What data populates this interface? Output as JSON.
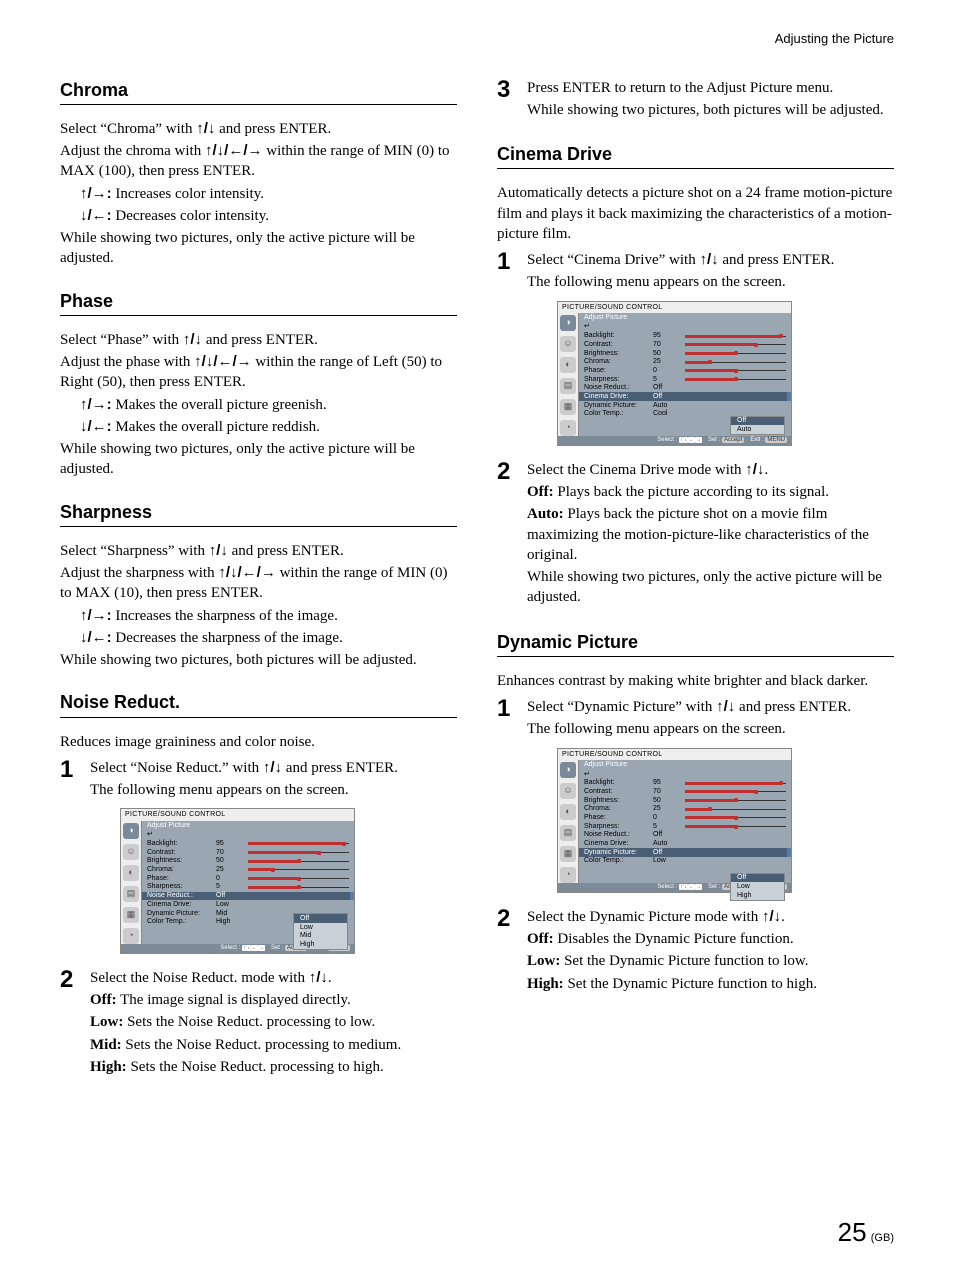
{
  "header": {
    "section": "Adjusting the Picture"
  },
  "arrows": {
    "up": "↑",
    "down": "↓",
    "left": "←",
    "right": "→",
    "updown": "↑/↓",
    "all": "↑/↓/←/→",
    "upright": "↑/→:",
    "downleft": "↓/←:"
  },
  "chroma": {
    "title": "Chroma",
    "p1a": "Select “Chroma” with ",
    "p1b": " and press ENTER.",
    "p2a": "Adjust the chroma with ",
    "p2b": " within the range of MIN (0) to MAX (100), then press ENTER.",
    "inc": " Increases color intensity.",
    "dec": " Decreases color intensity.",
    "note": "While showing two pictures, only the active picture will be adjusted."
  },
  "phase": {
    "title": "Phase",
    "p1a": "Select “Phase” with ",
    "p1b": " and press ENTER.",
    "p2a": "Adjust the phase with ",
    "p2b": " within the range of Left (50) to Right (50), then press ENTER.",
    "inc": " Makes the overall picture greenish.",
    "dec": " Makes the overall picture reddish.",
    "note": "While showing two pictures, only the active picture will be adjusted."
  },
  "sharp": {
    "title": "Sharpness",
    "p1a": "Select “Sharpness” with ",
    "p1b": " and press ENTER.",
    "p2a": "Adjust the sharpness with ",
    "p2b": " within the range of MIN (0) to MAX (10), then press ENTER.",
    "inc": " Increases the sharpness of the image.",
    "dec": " Decreases the sharpness of the image.",
    "note": "While showing two pictures, both pictures will be adjusted."
  },
  "noise": {
    "title": "Noise Reduct.",
    "intro": "Reduces image graininess and color noise.",
    "s1a": "Select “Noise Reduct.” with ",
    "s1b": " and press ENTER.",
    "s1c": "The following menu appears on the screen.",
    "s2a": "Select the Noise Reduct. mode with ",
    "s2b": ".",
    "off_l": "Off:",
    "off_t": " The image signal is displayed directly.",
    "low_l": "Low:",
    "low_t": " Sets the Noise Reduct. processing to low.",
    "mid_l": "Mid:",
    "mid_t": " Sets the Noise Reduct. processing to medium.",
    "high_l": "High:",
    "high_t": " Sets the Noise Reduct. processing to high."
  },
  "step3": {
    "a": "Press ENTER to return to the Adjust Picture menu.",
    "b": "While showing two pictures, both pictures will be adjusted."
  },
  "cinema": {
    "title": "Cinema Drive",
    "intro": "Automatically detects a picture shot on a 24 frame motion-picture film and plays it back maximizing the characteristics of a motion-picture film.",
    "s1a": "Select “Cinema Drive” with ",
    "s1b": " and press ENTER.",
    "s1c": "The following menu appears on the screen.",
    "s2a": "Select the Cinema Drive mode with ",
    "s2b": ".",
    "off_l": "Off:",
    "off_t": " Plays back the picture according to its signal.",
    "auto_l": "Auto:",
    "auto_t": " Plays back the picture shot on a movie film maximizing the motion-picture-like characteristics of the original.",
    "note": "While showing two pictures, only the active picture will be adjusted."
  },
  "dynamic": {
    "title": "Dynamic Picture",
    "intro": "Enhances contrast by making white brighter and black darker.",
    "s1a": "Select “Dynamic Picture” with ",
    "s1b": " and press ENTER.",
    "s1c": "The following menu appears on the screen.",
    "s2a": "Select the Dynamic Picture mode with ",
    "s2b": ".",
    "off_l": "Off:",
    "off_t": " Disables the Dynamic Picture function.",
    "low_l": "Low:",
    "low_t": " Set the Dynamic Picture function to low.",
    "high_l": "High:",
    "high_t": " Set the Dynamic Picture function to high."
  },
  "menu": {
    "title": "PICTURE/SOUND CONTROL",
    "header": "Adjust Picture",
    "return": "↵",
    "rows": [
      {
        "label": "Backlight:",
        "value": "95",
        "pct": 95
      },
      {
        "label": "Contrast:",
        "value": "70",
        "pct": 70
      },
      {
        "label": "Brightness:",
        "value": "50",
        "pct": 50
      },
      {
        "label": "Chroma:",
        "value": "25",
        "pct": 25
      },
      {
        "label": "Phase:",
        "value": "0",
        "pct": 50
      },
      {
        "label": "Sharpness:",
        "value": "5",
        "pct": 50
      }
    ],
    "noise": {
      "label": "Noise Reduct.:",
      "value": "Off"
    },
    "cinema": {
      "label": "Cinema Drive:",
      "value": "Off"
    },
    "cinema_auto": "Auto",
    "dynamic": {
      "label": "Dynamic Picture:",
      "value": "Auto"
    },
    "dynamic_mid": "Mid",
    "dynamic_low": "Low",
    "color": {
      "label": "Color Temp.:",
      "value": "Cool"
    },
    "color_high": "High",
    "footer": {
      "select": "Select :",
      "set": "Set :",
      "exit": "Exit :",
      "accept": "Accept"
    },
    "popup_noise": [
      "Off",
      "Low",
      "Mid",
      "High"
    ],
    "popup_cinema": [
      "Off",
      "Auto"
    ],
    "popup_dyn": [
      "Off",
      "Low",
      "High"
    ]
  },
  "footer": {
    "page": "25",
    "region": "(GB)"
  },
  "nums": {
    "n1": "1",
    "n2": "2",
    "n3": "3"
  }
}
